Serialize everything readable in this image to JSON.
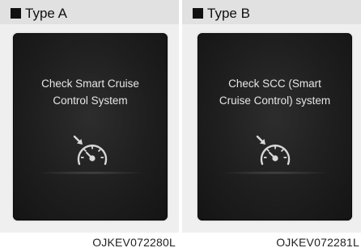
{
  "panels": [
    {
      "title": "Type A",
      "message_lines": [
        "Check Smart Cruise",
        "Control System"
      ],
      "icon": "smart-cruise-gauge-icon",
      "image_code": "OJKEV072280L"
    },
    {
      "title": "Type B",
      "message_lines": [
        "Check SCC (Smart",
        "Cruise Control) system"
      ],
      "icon": "smart-cruise-gauge-icon",
      "image_code": "OJKEV072281L"
    }
  ],
  "colors": {
    "header_bg": "#e1e1e1",
    "body_bg": "#efefef",
    "screen_bg": "#1e1e1e",
    "screen_text": "#e6e6e6",
    "icon_color": "#d9d9d9"
  }
}
